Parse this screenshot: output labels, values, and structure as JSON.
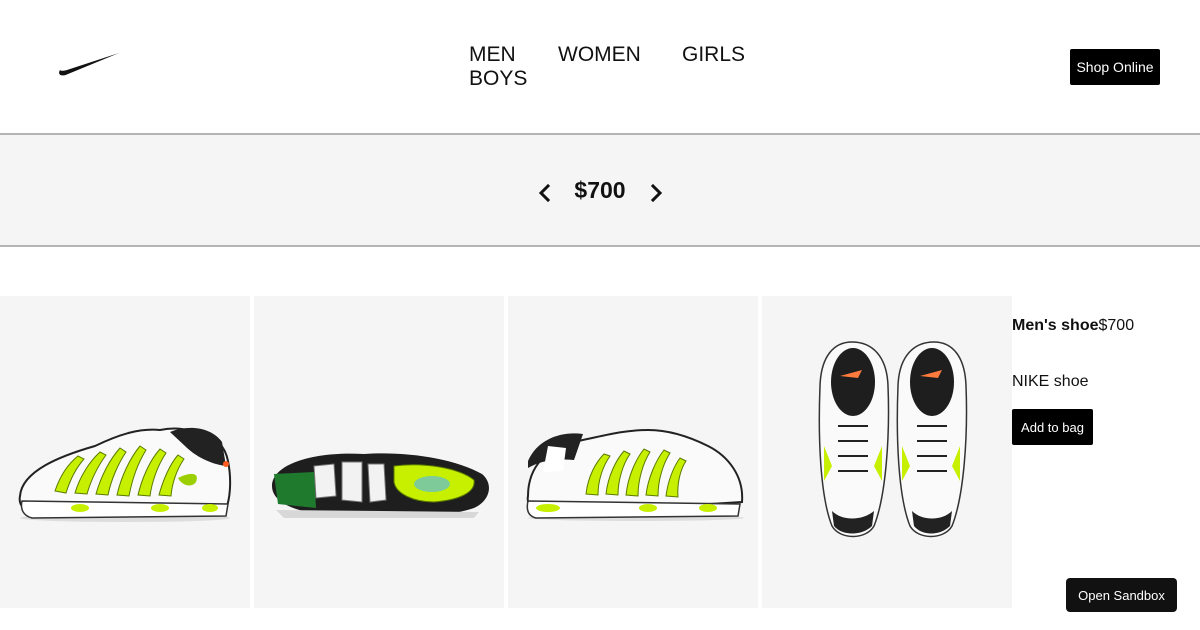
{
  "header": {
    "logo_icon": "nike-swoosh-icon",
    "nav": [
      {
        "label": "MEN"
      },
      {
        "label": "WOMEN"
      },
      {
        "label": "GIRLS"
      },
      {
        "label": "BOYS"
      }
    ],
    "shop_button_label": "Shop Online"
  },
  "price_selector": {
    "value": "$700",
    "prev_icon": "chevron-left-icon",
    "next_icon": "chevron-right-icon"
  },
  "gallery": {
    "images": [
      {
        "view": "side-view",
        "icon": "shoe-side-icon"
      },
      {
        "view": "sole-view",
        "icon": "shoe-sole-icon"
      },
      {
        "view": "side-view-alt",
        "icon": "shoe-side-icon"
      },
      {
        "view": "top-view-pair",
        "icon": "shoe-pair-top-icon"
      }
    ]
  },
  "product": {
    "name": "Men's shoe",
    "price": "$700",
    "description": "NIKE shoe",
    "add_button_label": "Add to bag"
  },
  "sandbox_button_label": "Open Sandbox",
  "colors": {
    "accent_volt": "#c6f000",
    "button_bg": "#000000",
    "band_bg": "#f5f5f5"
  }
}
